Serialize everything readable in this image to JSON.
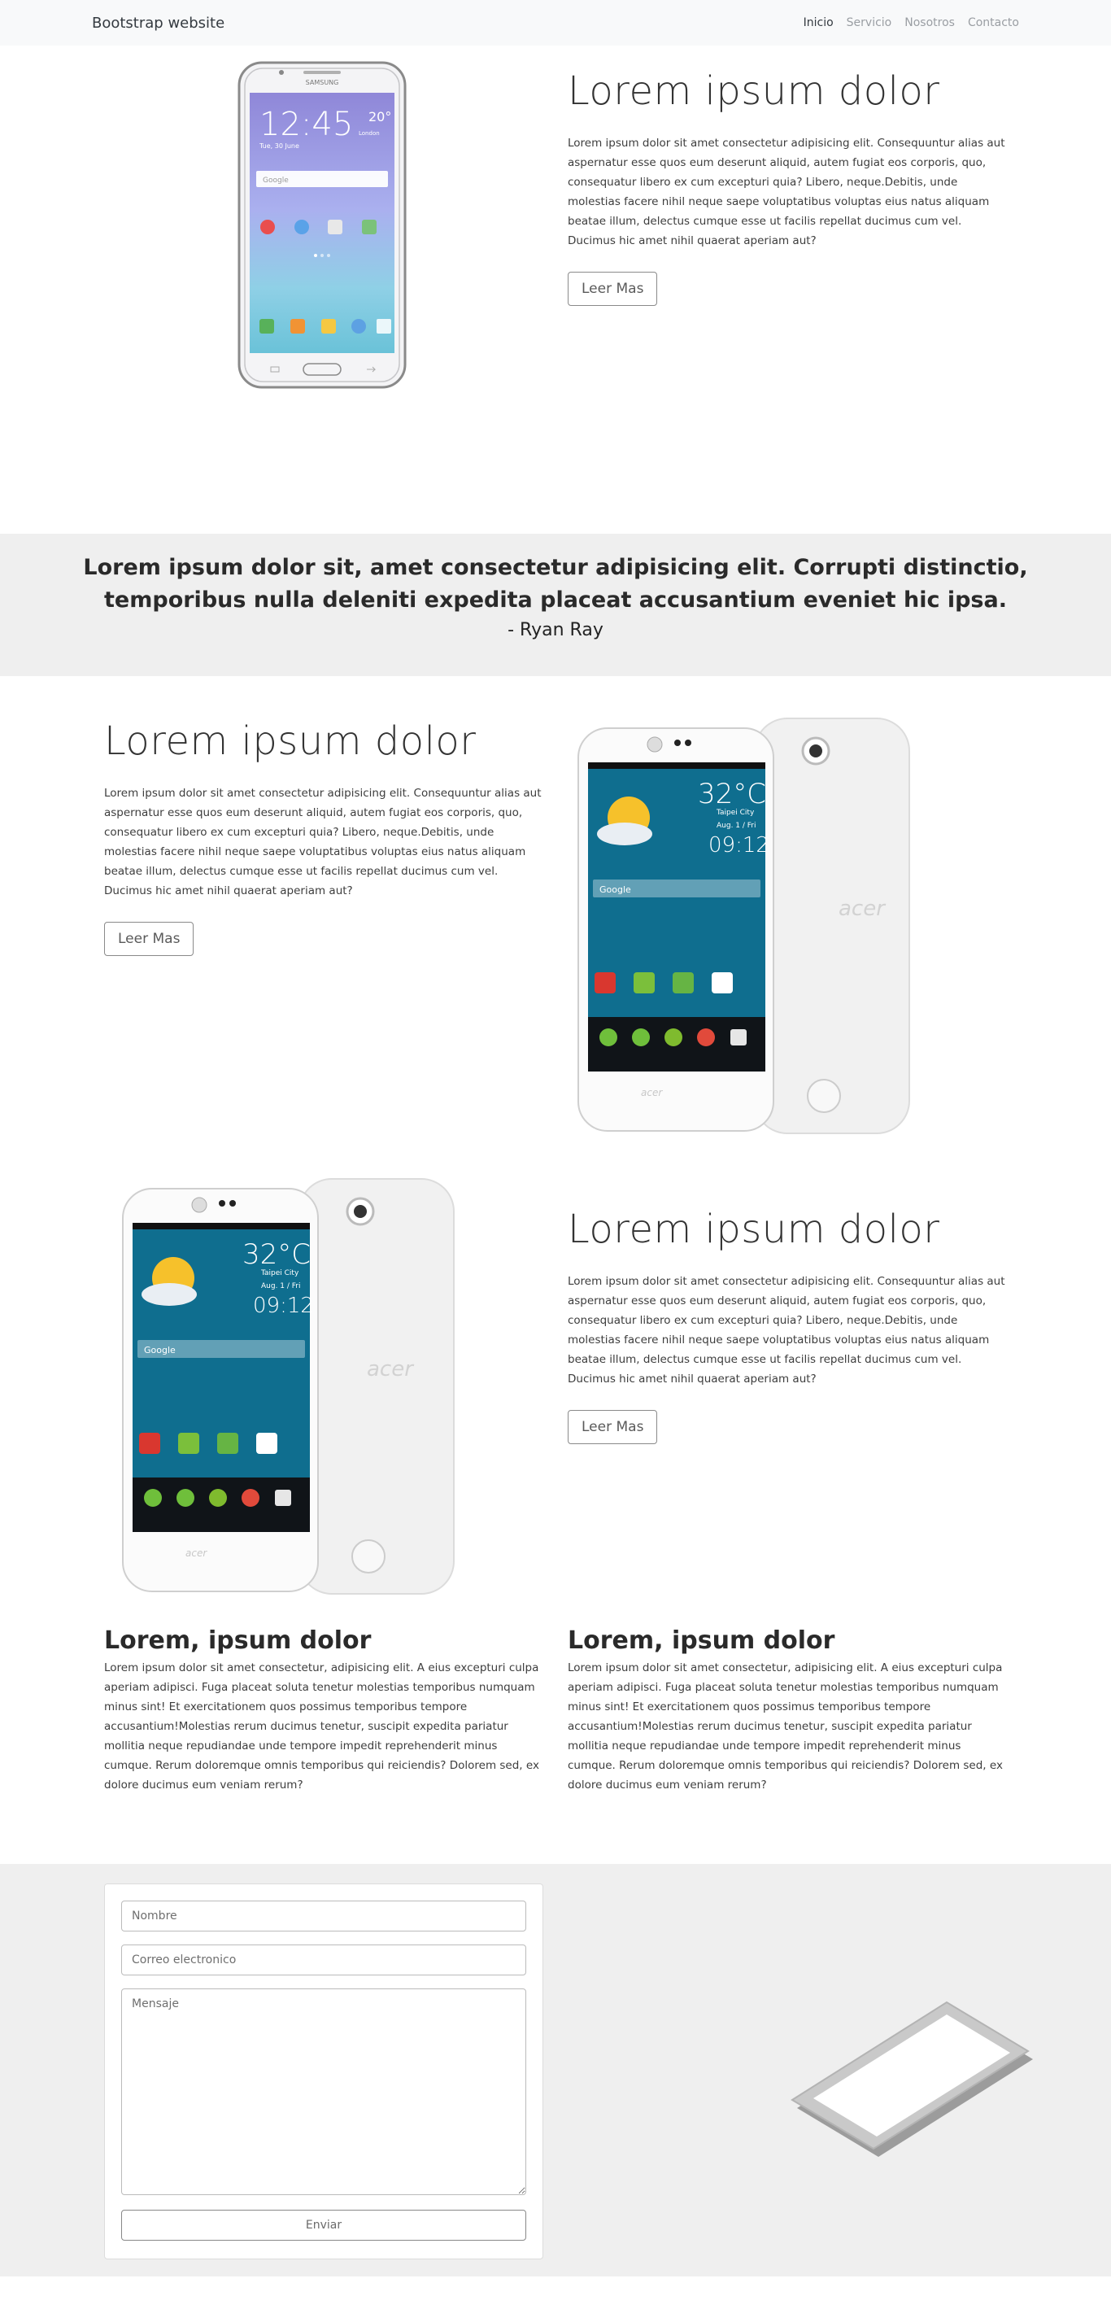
{
  "navbar": {
    "brand": "Bootstrap website",
    "links": [
      "Inicio",
      "Servicio",
      "Nosotros",
      "Contacto"
    ]
  },
  "features": [
    {
      "title": "Lorem ipsum dolor",
      "text": "Lorem ipsum dolor sit amet consectetur adipisicing elit. Consequuntur alias aut aspernatur esse quos eum deserunt aliquid, autem fugiat eos corporis, quo, consequatur libero ex cum excepturi quia? Libero, neque.Debitis, unde molestias facere nihil neque saepe voluptatibus voluptas eius natus aliquam beatae illum, delectus cumque esse ut facilis repellat ducimus cum vel. Ducimus hic amet nihil quaerat aperiam aut?",
      "button": "Leer Mas",
      "phone_brand": "SAMSUNG",
      "phone_time": "12:45",
      "phone_date": "Tue, 30 June",
      "phone_temp": "20°",
      "phone_city": "London",
      "phone_search": "Google"
    },
    {
      "title": "Lorem ipsum dolor",
      "text": "Lorem ipsum dolor sit amet consectetur adipisicing elit. Consequuntur alias aut aspernatur esse quos eum deserunt aliquid, autem fugiat eos corporis, quo, consequatur libero ex cum excepturi quia? Libero, neque.Debitis, unde molestias facere nihil neque saepe voluptatibus voluptas eius natus aliquam beatae illum, delectus cumque esse ut facilis repellat ducimus cum vel. Ducimus hic amet nihil quaerat aperiam aut?",
      "button": "Leer Mas",
      "phone_temp": "32°C",
      "phone_city": "Taipei City",
      "phone_date": "Aug. 1 / Fri",
      "phone_time": "09:12",
      "phone_brand": "acer",
      "phone_search": "Google"
    },
    {
      "title": "Lorem ipsum dolor",
      "text": "Lorem ipsum dolor sit amet consectetur adipisicing elit. Consequuntur alias aut aspernatur esse quos eum deserunt aliquid, autem fugiat eos corporis, quo, consequatur libero ex cum excepturi quia? Libero, neque.Debitis, unde molestias facere nihil neque saepe voluptatibus voluptas eius natus aliquam beatae illum, delectus cumque esse ut facilis repellat ducimus cum vel. Ducimus hic amet nihil quaerat aperiam aut?",
      "button": "Leer Mas",
      "phone_temp": "32°C",
      "phone_city": "Taipei City",
      "phone_date": "Aug. 1 / Fri",
      "phone_time": "09:12",
      "phone_brand": "acer",
      "phone_search": "Google"
    }
  ],
  "quote": {
    "line1": "Lorem ipsum dolor sit, amet consectetur adipisicing elit. Corrupti distinctio,",
    "line2": "temporibus nulla deleniti expedita placeat accusantium eveniet hic ipsa.",
    "author": "- Ryan Ray"
  },
  "cards": [
    {
      "title": "Lorem, ipsum dolor",
      "text": "Lorem ipsum dolor sit amet consectetur, adipisicing elit. A eius excepturi culpa aperiam adipisci. Fuga placeat soluta tenetur molestias temporibus numquam minus sint! Et exercitationem quos possimus temporibus tempore accusantium!Molestias rerum ducimus tenetur, suscipit expedita pariatur mollitia neque repudiandae unde tempore impedit reprehenderit minus cumque. Rerum doloremque omnis temporibus qui reiciendis? Dolorem sed, ex dolore ducimus eum veniam rerum?"
    },
    {
      "title": "Lorem, ipsum dolor",
      "text": "Lorem ipsum dolor sit amet consectetur, adipisicing elit. A eius excepturi culpa aperiam adipisci. Fuga placeat soluta tenetur molestias temporibus numquam minus sint! Et exercitationem quos possimus temporibus tempore accusantium!Molestias rerum ducimus tenetur, suscipit expedita pariatur mollitia neque repudiandae unde tempore impedit reprehenderit minus cumque. Rerum doloremque omnis temporibus qui reiciendis? Dolorem sed, ex dolore ducimus eum veniam rerum?"
    }
  ],
  "form": {
    "name_placeholder": "Nombre",
    "email_placeholder": "Correo electronico",
    "message_placeholder": "Mensaje",
    "submit": "Enviar"
  },
  "colors": {
    "navbar_bg": "#f8f9fa",
    "section_gray": "#efefef",
    "acer_screen": "#0f6e8f"
  }
}
